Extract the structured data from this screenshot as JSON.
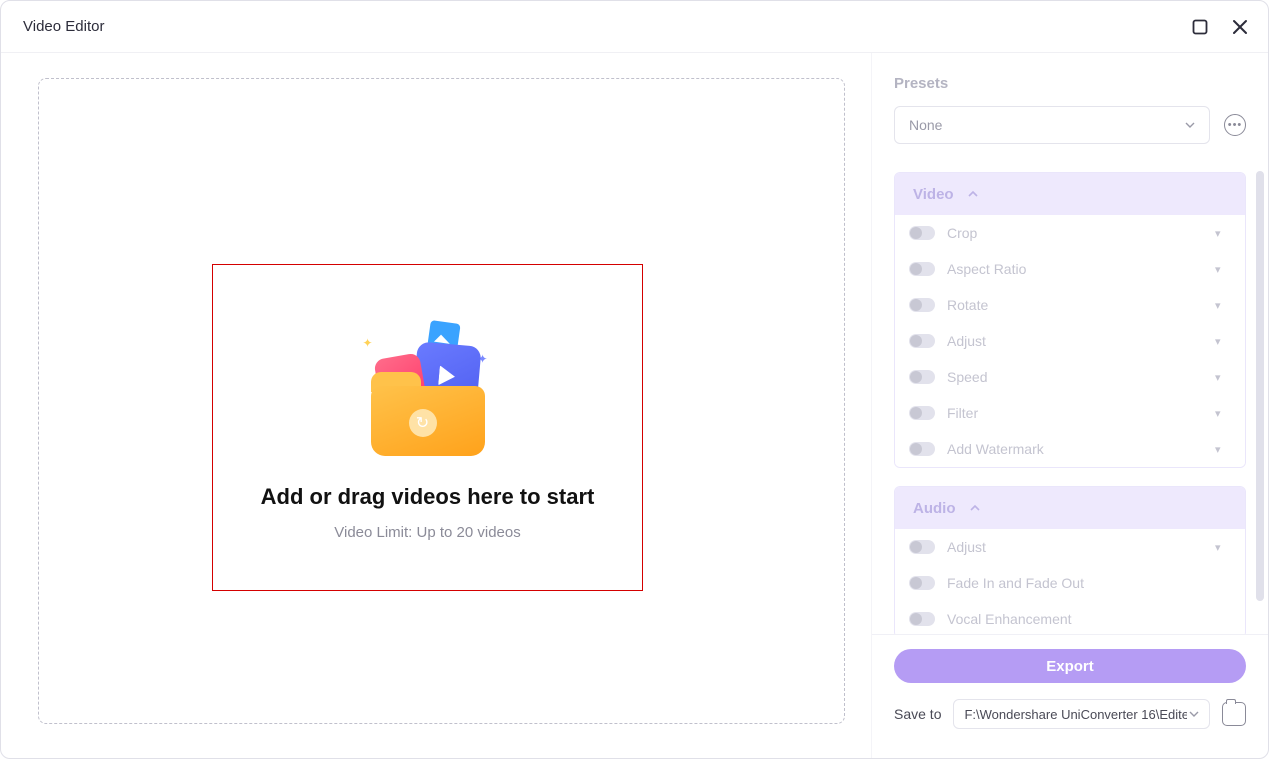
{
  "window": {
    "title": "Video Editor"
  },
  "dropzone": {
    "heading": "Add or drag videos here to start",
    "subtext": "Video Limit: Up to 20 videos"
  },
  "presets": {
    "label": "Presets",
    "selected": "None"
  },
  "sections": {
    "video": {
      "title": "Video",
      "options": [
        "Crop",
        "Aspect Ratio",
        "Rotate",
        "Adjust",
        "Speed",
        "Filter",
        "Add Watermark"
      ]
    },
    "audio": {
      "title": "Audio",
      "options": [
        "Adjust",
        "Fade In and Fade Out",
        "Vocal Enhancement"
      ]
    }
  },
  "footer": {
    "export": "Export",
    "saveLabel": "Save to",
    "savePath": "F:\\Wondershare UniConverter 16\\Edite"
  }
}
